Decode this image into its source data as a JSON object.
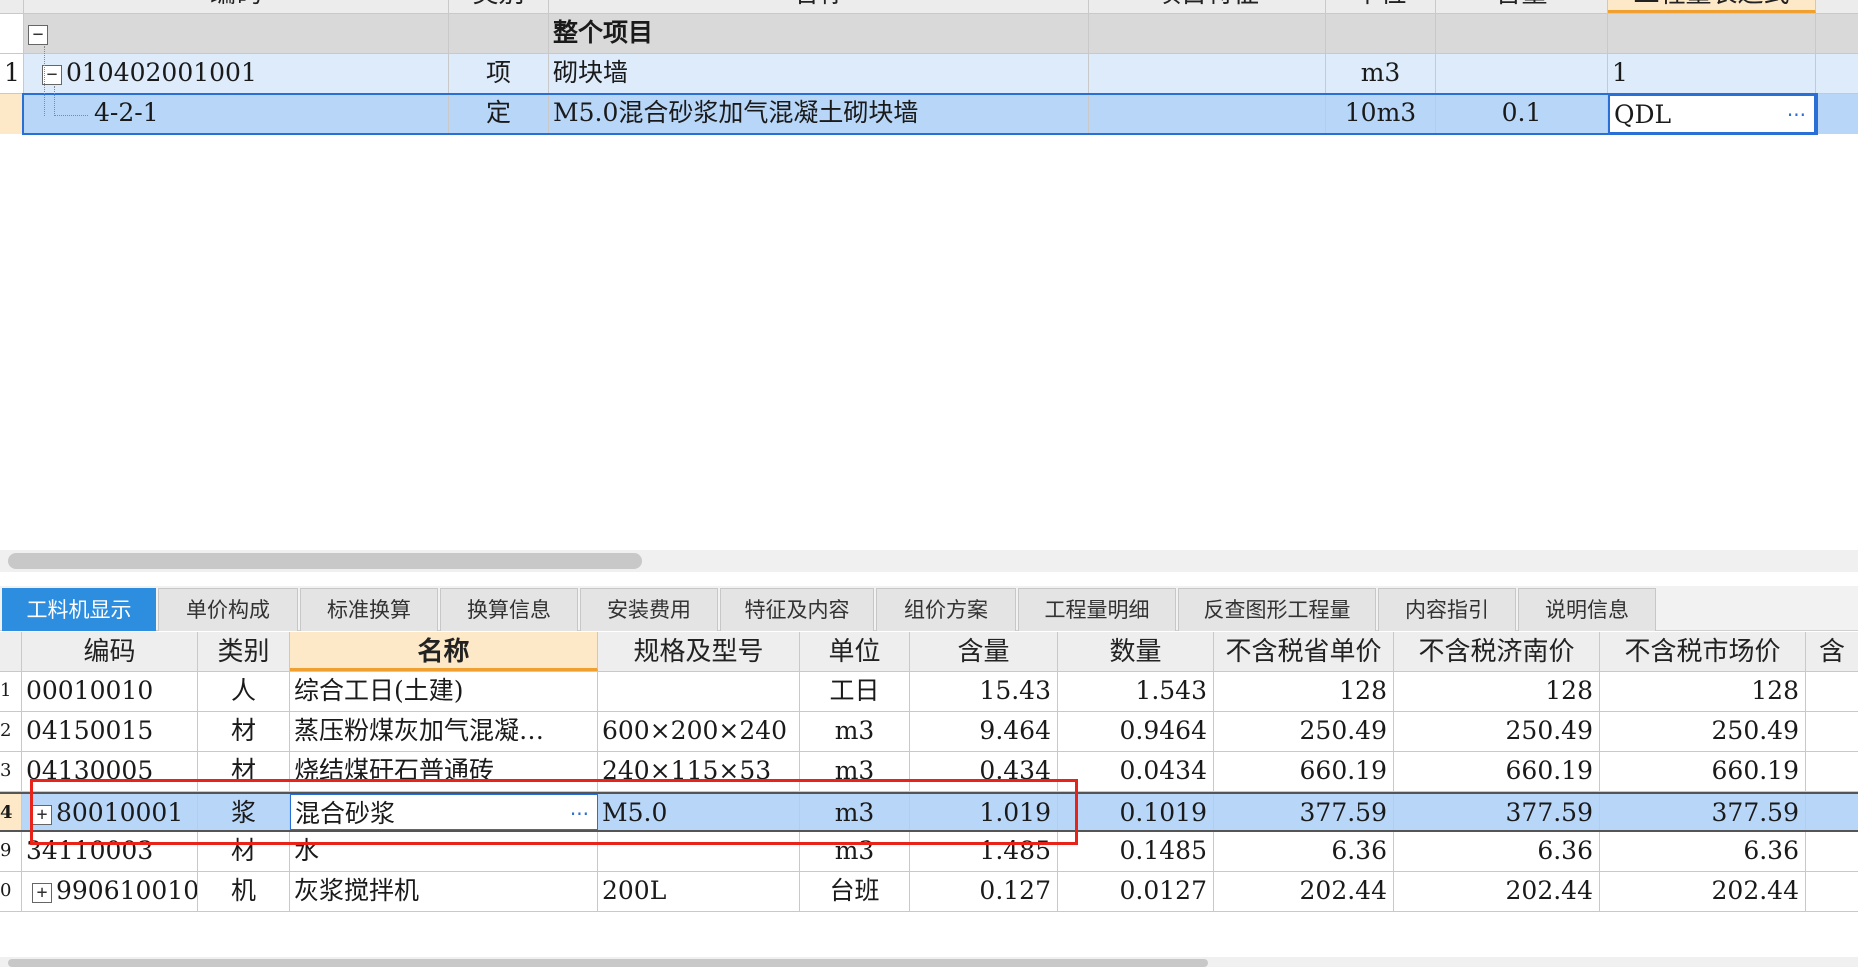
{
  "top_grid": {
    "header": [
      "编码",
      "类别",
      "名称",
      "项目特征",
      "单位",
      "含量",
      "工程量表达式"
    ],
    "rows": [
      {
        "num": "",
        "code": "",
        "type": "",
        "name": "整个项目",
        "feature": "",
        "unit": "",
        "content": "",
        "expr": "",
        "expander": "−"
      },
      {
        "num": "1",
        "code": "010402001001",
        "type": "项",
        "name": "砌块墙",
        "feature": "",
        "unit": "m3",
        "content": "",
        "expr": "1",
        "expander": "−"
      },
      {
        "num": "",
        "code": "4-2-1",
        "type": "定",
        "name": "M5.0混合砂浆加气混凝土砌块墙",
        "feature": "",
        "unit": "10m3",
        "content": "0.1",
        "expr": "QDL",
        "expander": ""
      }
    ],
    "ellipsis": "···"
  },
  "tabs": [
    {
      "label": "工料机显示",
      "active": true
    },
    {
      "label": "单价构成",
      "active": false
    },
    {
      "label": "标准换算",
      "active": false
    },
    {
      "label": "换算信息",
      "active": false
    },
    {
      "label": "安装费用",
      "active": false
    },
    {
      "label": "特征及内容",
      "active": false
    },
    {
      "label": "组价方案",
      "active": false
    },
    {
      "label": "工程量明细",
      "active": false
    },
    {
      "label": "反查图形工程量",
      "active": false
    },
    {
      "label": "内容指引",
      "active": false
    },
    {
      "label": "说明信息",
      "active": false
    }
  ],
  "bottom_grid": {
    "header": [
      "编码",
      "类别",
      "名称",
      "规格及型号",
      "单位",
      "含量",
      "数量",
      "不含税省单价",
      "不含税济南价",
      "不含税市场价",
      "含"
    ],
    "rows": [
      {
        "num": "1",
        "code": "00010010",
        "type": "人",
        "name": "综合工日(土建)",
        "spec": "",
        "unit": "工日",
        "content": "15.43",
        "qty": "1.543",
        "prov_price": "128",
        "jinan_price": "128",
        "market_price": "128",
        "expander": ""
      },
      {
        "num": "2",
        "code": "04150015",
        "type": "材",
        "name": "蒸压粉煤灰加气混凝…",
        "spec": "600×200×240",
        "unit": "m3",
        "content": "9.464",
        "qty": "0.9464",
        "prov_price": "250.49",
        "jinan_price": "250.49",
        "market_price": "250.49",
        "expander": ""
      },
      {
        "num": "3",
        "code": "04130005",
        "type": "材",
        "name": "烧结煤矸石普通砖",
        "spec": "240×115×53",
        "unit": "m3",
        "content": "0.434",
        "qty": "0.0434",
        "prov_price": "660.19",
        "jinan_price": "660.19",
        "market_price": "660.19",
        "expander": ""
      },
      {
        "num": "4",
        "code": "80010001",
        "type": "浆",
        "name": "混合砂浆",
        "spec": "M5.0",
        "unit": "m3",
        "content": "1.019",
        "qty": "0.1019",
        "prov_price": "377.59",
        "jinan_price": "377.59",
        "market_price": "377.59",
        "expander": "+"
      },
      {
        "num": "9",
        "code": "34110003",
        "type": "材",
        "name": "水",
        "spec": "",
        "unit": "m3",
        "content": "1.485",
        "qty": "0.1485",
        "prov_price": "6.36",
        "jinan_price": "6.36",
        "market_price": "6.36",
        "expander": ""
      },
      {
        "num": "0",
        "code": "990610010",
        "type": "机",
        "name": "灰浆搅拌机",
        "spec": "200L",
        "unit": "台班",
        "content": "0.127",
        "qty": "0.0127",
        "prov_price": "202.44",
        "jinan_price": "202.44",
        "market_price": "202.44",
        "expander": "+"
      }
    ],
    "ellipsis": "···"
  },
  "colors": {
    "selected_row": "#b8d6f8",
    "light_row": "#ddebfb",
    "group_row": "#d9d9d9",
    "active_tab": "#2d8ee0",
    "highlight_box": "#e8231a",
    "focus_border": "#2a6fd6"
  }
}
